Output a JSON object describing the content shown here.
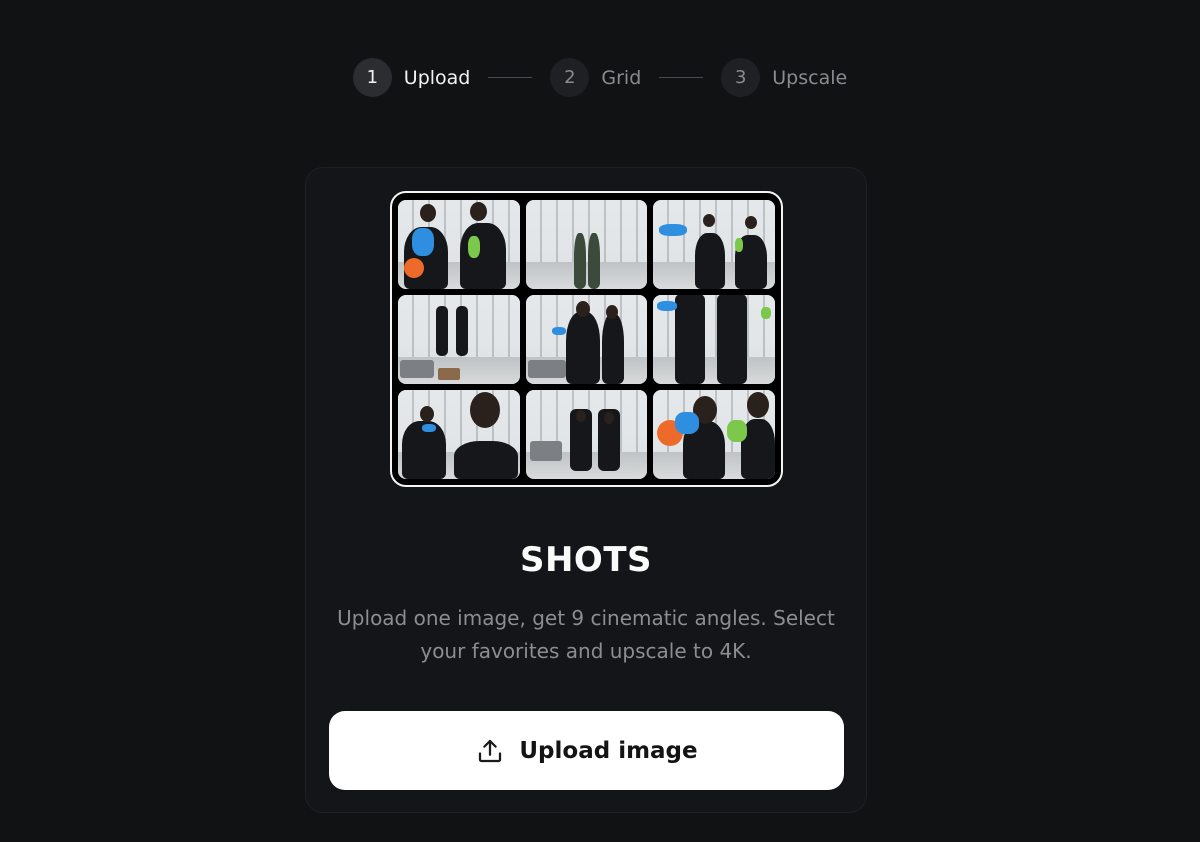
{
  "stepper": {
    "steps": [
      {
        "number": "1",
        "label": "Upload",
        "active": true
      },
      {
        "number": "2",
        "label": "Grid",
        "active": false
      },
      {
        "number": "3",
        "label": "Upscale",
        "active": false
      }
    ]
  },
  "card": {
    "title": "SHOTS",
    "description": "Upload one image, get 9 cinematic angles. Select your favorites and upscale to 4K.",
    "upload_button": {
      "label": "Upload image",
      "icon": "upload-icon"
    }
  },
  "colors": {
    "background": "#111214",
    "card": "#141518",
    "button": "#ffffff",
    "muted_text": "#8c8d91"
  }
}
